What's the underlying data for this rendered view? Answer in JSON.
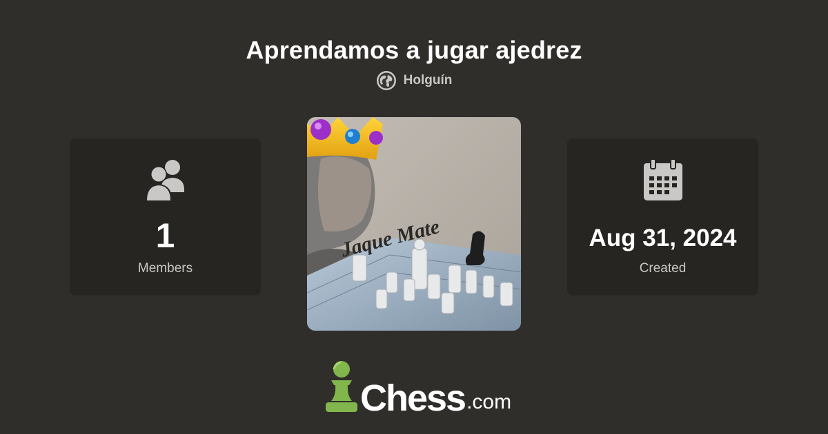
{
  "header": {
    "title": "Aprendamos a jugar ajedrez",
    "location": "Holguín",
    "location_icon": "globe-icon"
  },
  "members_card": {
    "icon": "members-icon",
    "value": "1",
    "label": "Members"
  },
  "club_avatar": {
    "overlay_text": "Jaque Mate"
  },
  "created_card": {
    "icon": "calendar-icon",
    "value": "Aug 31, 2024",
    "label": "Created"
  },
  "brand": {
    "icon": "pawn-icon",
    "name": "Chess",
    "tld": ".com",
    "accent": "#81b64c"
  },
  "colors": {
    "background": "#302e2b",
    "card": "#262522",
    "text_primary": "#ffffff",
    "text_secondary": "#c9c8c6"
  }
}
